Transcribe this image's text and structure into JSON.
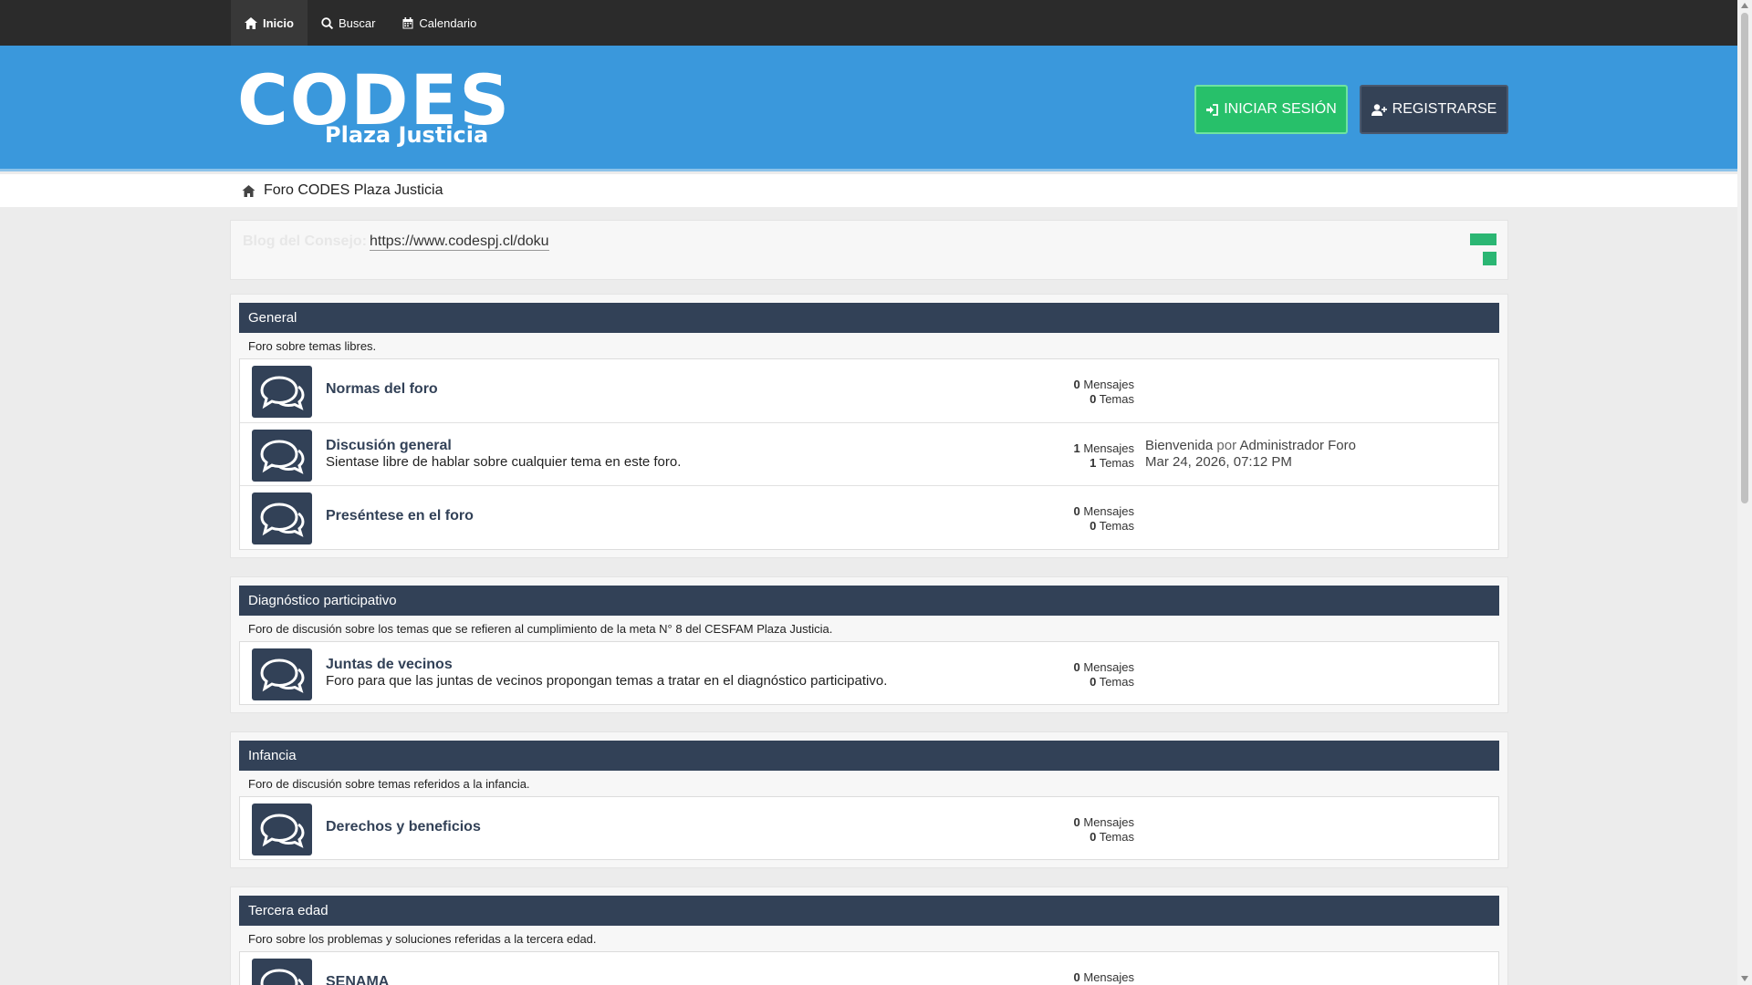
{
  "nav": {
    "items": [
      {
        "label": "Inicio",
        "icon": "home-icon",
        "active": true
      },
      {
        "label": "Buscar",
        "icon": "search-icon",
        "active": false
      },
      {
        "label": "Calendario",
        "icon": "calendar-icon",
        "active": false
      }
    ]
  },
  "header": {
    "logo_main": "CODES",
    "logo_sub": "Plaza Justicia",
    "login_label": "INICIAR SESIÓN",
    "register_label": "REGISTRARSE",
    "colors": {
      "header_bg": "#3a98dc",
      "login_bg": "#27c06a",
      "register_bg": "#344256"
    }
  },
  "breadcrumb": {
    "label": "Foro CODES Plaza Justicia"
  },
  "notice": {
    "label": "Blog del Consejo:",
    "link": "https://www.codespj.cl/doku"
  },
  "categories": [
    {
      "title": "General",
      "description": "Foro sobre temas libres.",
      "forums": [
        {
          "title": "Normas del foro",
          "description": "",
          "posts": "0",
          "posts_label": "Mensajes",
          "topics": "0",
          "topics_label": "Temas"
        },
        {
          "title": "Discusión general",
          "description": "Sientase libre de hablar sobre cualquier tema en este foro.",
          "posts": "1",
          "posts_label": "Mensajes",
          "topics": "1",
          "topics_label": "Temas",
          "last_post": {
            "title": "Bienvenida",
            "by": "por",
            "author": "Administrador Foro",
            "date": "Mar 24, 2026, 07:12 PM"
          }
        },
        {
          "title": "Preséntese en el foro",
          "description": "",
          "posts": "0",
          "posts_label": "Mensajes",
          "topics": "0",
          "topics_label": "Temas"
        }
      ]
    },
    {
      "title": "Diagnóstico participativo",
      "description": "Foro de discusión sobre los temas que se refieren al cumplimiento de la meta N° 8 del CESFAM Plaza Justicia.",
      "forums": [
        {
          "title": "Juntas de vecinos",
          "description": "Foro para que las juntas de vecinos propongan temas a tratar en el diagnóstico participativo.",
          "posts": "0",
          "posts_label": "Mensajes",
          "topics": "0",
          "topics_label": "Temas"
        }
      ]
    },
    {
      "title": "Infancia",
      "description": "Foro de discusión sobre temas referidos a la infancia.",
      "forums": [
        {
          "title": "Derechos y beneficios",
          "description": "",
          "posts": "0",
          "posts_label": "Mensajes",
          "topics": "0",
          "topics_label": "Temas"
        }
      ]
    },
    {
      "title": "Tercera edad",
      "description": "Foro sobre los problemas y soluciones referidas a la tercera edad.",
      "forums": [
        {
          "title": "SENAMA",
          "description": "",
          "posts": "0",
          "posts_label": "Mensajes",
          "topics": "",
          "topics_label": ""
        }
      ]
    }
  ]
}
